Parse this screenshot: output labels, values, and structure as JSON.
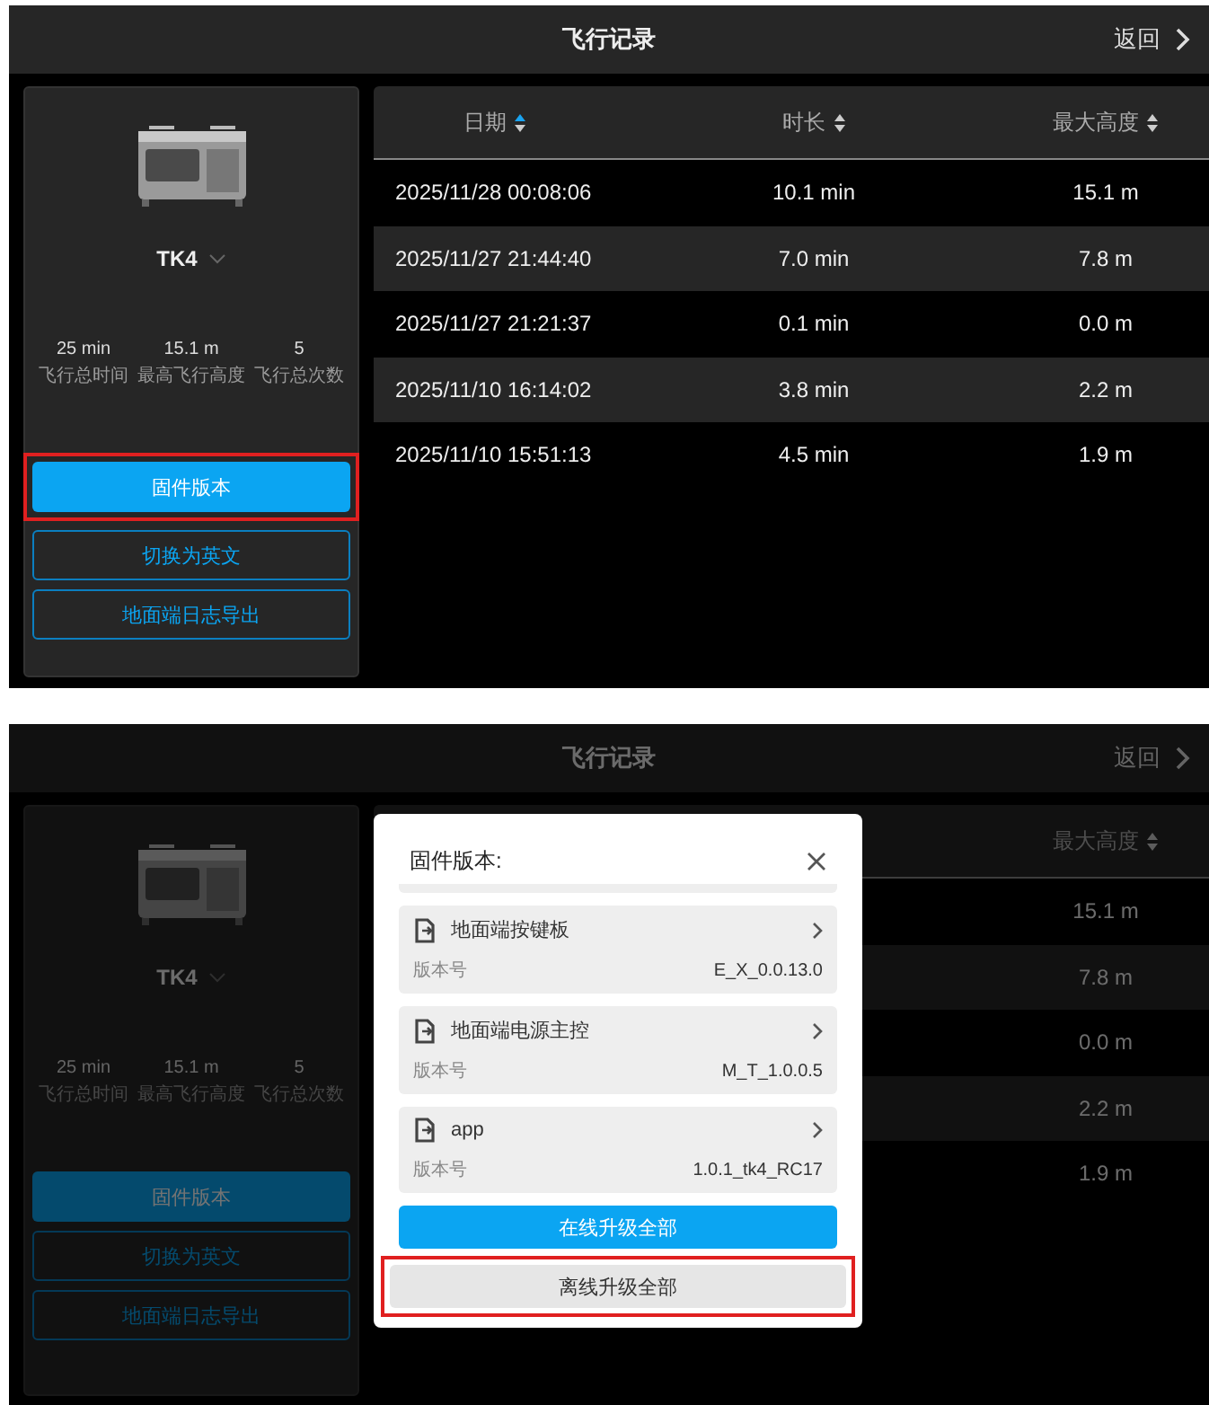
{
  "screens": [
    {
      "title": "飞行记录",
      "back": "返回",
      "device": {
        "name": "TK4"
      },
      "stats": [
        {
          "value": "25 min",
          "label": "飞行总时间"
        },
        {
          "value": "15.1 m",
          "label": "最高飞行高度"
        },
        {
          "value": "5",
          "label": "飞行总次数"
        }
      ],
      "buttons": [
        {
          "label": "固件版本",
          "kind": "primary",
          "highlighted": true
        },
        {
          "label": "切换为英文",
          "kind": "outline",
          "highlighted": false
        },
        {
          "label": "地面端日志导出",
          "kind": "outline",
          "highlighted": false
        }
      ],
      "table": {
        "columns": [
          {
            "label": "日期",
            "sorted": true
          },
          {
            "label": "时长",
            "sorted": false
          },
          {
            "label": "最大高度",
            "sorted": false
          }
        ],
        "rows": [
          [
            "2025/11/28 00:08:06",
            "10.1 min",
            "15.1 m"
          ],
          [
            "2025/11/27 21:44:40",
            "7.0 min",
            "7.8 m"
          ],
          [
            "2025/11/27 21:21:37",
            "0.1 min",
            "0.0 m"
          ],
          [
            "2025/11/10 16:14:02",
            "3.8 min",
            "2.2 m"
          ],
          [
            "2025/11/10 15:51:13",
            "4.5 min",
            "1.9 m"
          ]
        ]
      }
    },
    {
      "title": "飞行记录",
      "back": "返回",
      "device": {
        "name": "TK4"
      },
      "stats": [
        {
          "value": "25 min",
          "label": "飞行总时间"
        },
        {
          "value": "15.1 m",
          "label": "最高飞行高度"
        },
        {
          "value": "5",
          "label": "飞行总次数"
        }
      ],
      "buttons": [
        {
          "label": "固件版本",
          "kind": "primary",
          "highlighted": false
        },
        {
          "label": "切换为英文",
          "kind": "outline",
          "highlighted": false
        },
        {
          "label": "地面端日志导出",
          "kind": "outline",
          "highlighted": false
        }
      ],
      "table": {
        "columns": [
          {
            "label": "最大高度",
            "sorted": false
          }
        ],
        "rows": [
          [
            "15.1 m"
          ],
          [
            "7.8 m"
          ],
          [
            "0.0 m"
          ],
          [
            "2.2 m"
          ],
          [
            "1.9 m"
          ]
        ]
      },
      "dialog": {
        "title": "固件版本:",
        "items": [
          {
            "name": "地面端按键板",
            "version_label": "版本号",
            "version": "E_X_0.0.13.0"
          },
          {
            "name": "地面端电源主控",
            "version_label": "版本号",
            "version": "M_T_1.0.0.5"
          },
          {
            "name": "app",
            "version_label": "版本号",
            "version": "1.0.1_tk4_RC17"
          }
        ],
        "buttons": [
          {
            "label": "在线升级全部",
            "kind": "primary",
            "highlighted": false
          },
          {
            "label": "离线升级全部",
            "kind": "secondary",
            "highlighted": true
          }
        ]
      }
    }
  ]
}
